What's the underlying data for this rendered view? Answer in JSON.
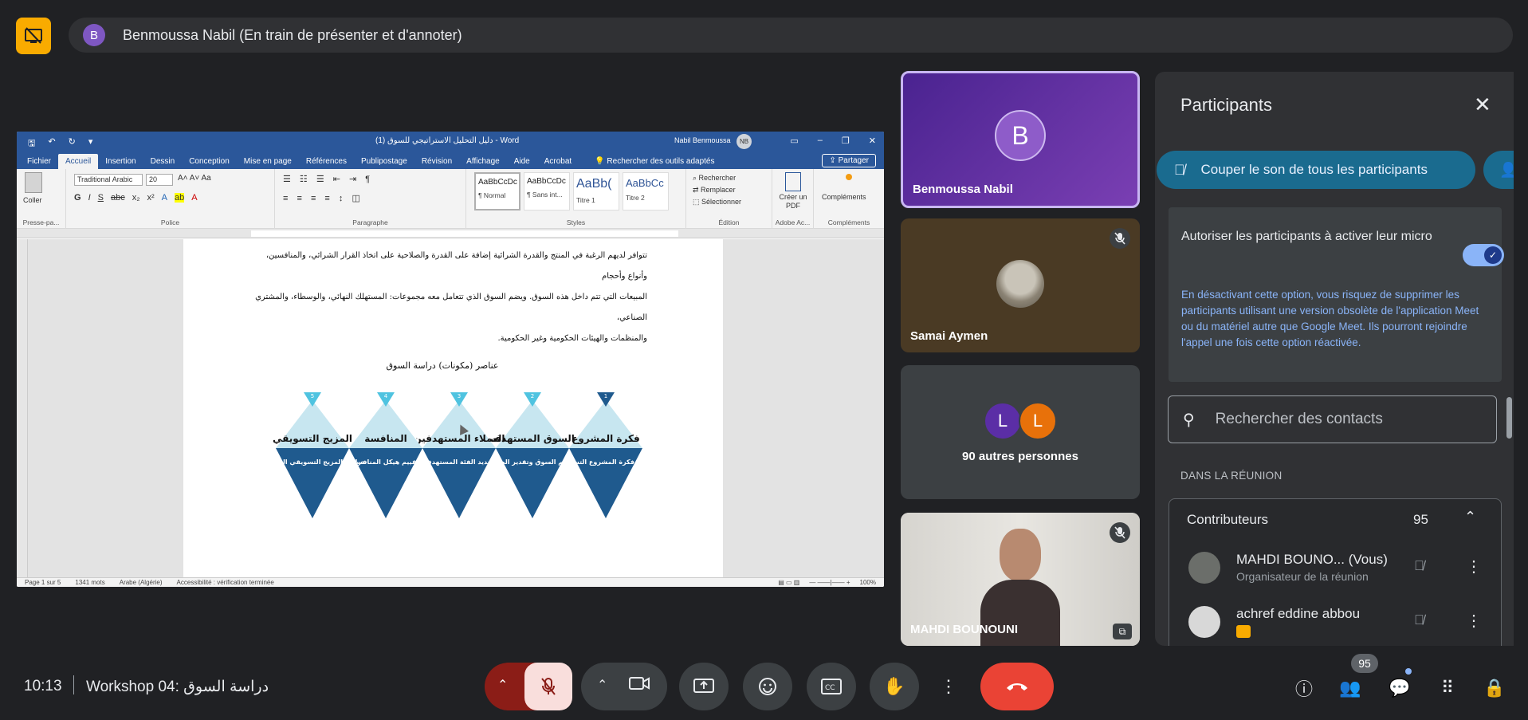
{
  "presenter": {
    "initial": "B",
    "banner": "Benmoussa Nabil (En train de présenter et d'annoter)"
  },
  "word": {
    "doc_title": "دليل التحليل الاستراتيجي للسوق (1) - Word",
    "user_name": "Nabil Benmoussa",
    "user_initials": "NB",
    "tabs": [
      "Fichier",
      "Accueil",
      "Insertion",
      "Dessin",
      "Conception",
      "Mise en page",
      "Références",
      "Publipostage",
      "Révision",
      "Affichage",
      "Aide",
      "Acrobat"
    ],
    "active_tab": "Accueil",
    "search_placeholder": "Rechercher des outils adaptés",
    "share_label": "Partager",
    "font_name": "Traditional Arabic",
    "font_size": "20",
    "paste_label": "Coller",
    "group_labels": [
      "Presse-pa...",
      "Police",
      "Paragraphe",
      "Styles",
      "Édition",
      "Adobe Ac...",
      "Compléments"
    ],
    "styles": [
      {
        "sample": "AaBbCcDc",
        "name": "¶ Normal"
      },
      {
        "sample": "AaBbCcDc",
        "name": "¶ Sans int..."
      },
      {
        "sample": "AaBb(",
        "name": "Titre 1"
      },
      {
        "sample": "AaBbCc",
        "name": "Titre 2"
      }
    ],
    "editing": [
      "Rechercher",
      "Remplacer",
      "Sélectionner"
    ],
    "pdf_label": "Créer un PDF",
    "addins_label": "Compléments",
    "paragraph_lines": [
      "تتوافر لديهم الرغبة في المنتج والقدرة الشرائية إضافة على القدرة والصلاحية على اتخاذ القرار الشرائي، والمنافسين، وأنواع وأحجام",
      "المبيعات التي تتم داخل هذه السوق. ويضم السوق الذي تتعامل معه مجموعات: المستهلك النهائي، والوسطاء، والمشتري الصناعي،",
      "والمنظمات والهيئات الحكومية وغير الحكومية."
    ],
    "diagram_title": "عناصر (مكونات) دراسة السوق",
    "diagram_items": [
      {
        "num": "1",
        "title": "فكرة المشروع",
        "desc": "دراسة فكرة المشروع التسويقية"
      },
      {
        "num": "2",
        "title": "السوق المستهدف",
        "desc": "تقييم السوق وتقدير الطلب"
      },
      {
        "num": "3",
        "title": "العملاء المستهدفين",
        "desc": "تحديد الفئة المستهدفة"
      },
      {
        "num": "4",
        "title": "المنافسة",
        "desc": "تقييم هيكل المنافسة"
      },
      {
        "num": "5",
        "title": "المزيج التسويقي",
        "desc": "دراسة المزيج التسويقي المتداول"
      }
    ],
    "status": {
      "page": "Page 1 sur 5",
      "words": "1341 mots",
      "language": "Arabe (Algérie)",
      "accessibility": "Accessibilité : vérification terminée",
      "zoom": "100%"
    }
  },
  "tiles": {
    "presenter_initial": "B",
    "presenter_name": "Benmoussa Nabil",
    "tile2_name": "Samai Aymen",
    "others_initials": [
      "L",
      "L"
    ],
    "others_label": "90 autres personnes",
    "tile4_name": "MAHDI BOUNOUNI"
  },
  "panel": {
    "title": "Participants",
    "mute_all": "Couper le son de tous les participants",
    "allow_mic_label": "Autoriser les participants à activer leur micro",
    "allow_mic_on": true,
    "warning": "En désactivant cette option, vous risquez de supprimer les participants utilisant une version obsolète de l'application Meet ou du matériel autre que Google Meet. Ils pourront rejoindre l'appel une fois cette option réactivée.",
    "search_placeholder": "Rechercher des contacts",
    "section_label": "DANS LA RÉUNION",
    "group_name": "Contributeurs",
    "group_count": "95",
    "participants": [
      {
        "name": "MAHDI BOUNO...   (Vous)",
        "role": "Organisateur de la réunion"
      },
      {
        "name": "achref eddine abbou",
        "role": ""
      }
    ]
  },
  "bottom": {
    "time": "10:13",
    "meeting_name": "Workshop 04: دراسة السوق",
    "people_count": "95"
  },
  "colors": {
    "accent_yellow": "#f9ab00",
    "word_blue": "#2b579a",
    "leave_red": "#ea4335",
    "mute_all_teal": "#1a6b8f"
  }
}
